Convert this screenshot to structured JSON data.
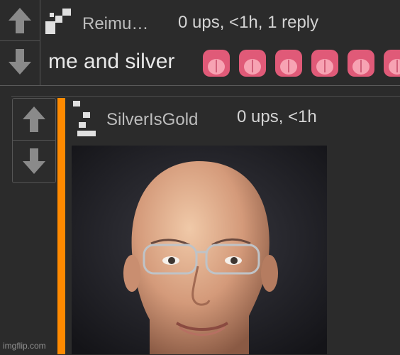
{
  "top_comment": {
    "username": "Reimu…",
    "meta": "0 ups, <1h, 1 reply",
    "text": "me and silver",
    "emoji_count": 6,
    "emoji_icon": "tongue-emoji"
  },
  "reply": {
    "username": "SilverIsGold",
    "meta": "0 ups, <1h",
    "accent_color": "#ff8a00",
    "image": "portrait-photo"
  },
  "watermark": "imgflip.com"
}
